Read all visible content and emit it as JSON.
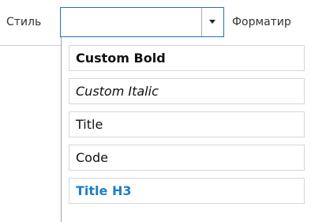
{
  "toolbar": {
    "style_label": "Стиль",
    "style_value": "",
    "format_label": "Форматир"
  },
  "dropdown": {
    "items": [
      {
        "label": "Custom Bold"
      },
      {
        "label": "Custom Italic"
      },
      {
        "label": "Title"
      },
      {
        "label": "Code"
      },
      {
        "label": "Title H3",
        "color": "#1f7fc7"
      }
    ]
  },
  "icons": {
    "combo_arrow": "chevron-down-icon"
  }
}
